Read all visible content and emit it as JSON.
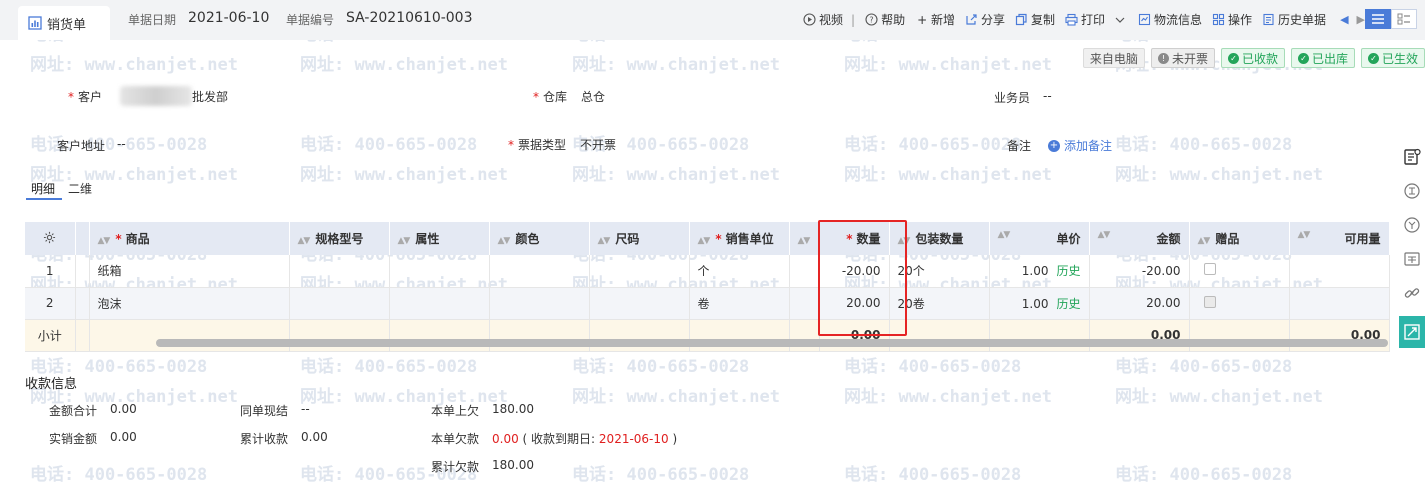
{
  "header": {
    "doc_title": "销货单",
    "date_label": "单据日期",
    "date_value": "2021-06-10",
    "number_label": "单据编号",
    "number_value": "SA-20210610-003"
  },
  "toolbar": {
    "video": "视频",
    "separator": "|",
    "help": "帮助",
    "add": "+ 新增",
    "share": "分享",
    "copy": "复制",
    "print": "打印",
    "logistics": "物流信息",
    "operate": "操作",
    "history": "历史单据"
  },
  "status_badges": {
    "source": "来自电脑",
    "invoice": "未开票",
    "received": "已收款",
    "shipped": "已出库",
    "effective": "已生效"
  },
  "form": {
    "customer_label": "客户",
    "customer_value": "批发部",
    "warehouse_label": "仓库",
    "warehouse_value": "总仓",
    "salesman_label": "业务员",
    "salesman_value": "--",
    "address_label": "客户地址",
    "address_value": "--",
    "invoice_type_label": "票据类型",
    "invoice_type_value": "不开票",
    "remark_label": "备注",
    "add_remark": "添加备注",
    "required_mark": "*"
  },
  "detail_tabs": {
    "detail": "明细",
    "dimension": "二维"
  },
  "table": {
    "headers": {
      "product": "商品",
      "spec": "规格型号",
      "attr": "属性",
      "color": "颜色",
      "size": "尺码",
      "sale_unit": "销售单位",
      "qty": "数量",
      "pack_qty": "包装数量",
      "price": "单价",
      "amount": "金额",
      "gift": "赠品",
      "available": "可用量"
    },
    "rows": [
      {
        "no": "1",
        "product": "纸箱",
        "unit": "个",
        "qty": "-20.00",
        "pack_qty": "20个",
        "price": "1.00",
        "history": "历史",
        "amount": "-20.00"
      },
      {
        "no": "2",
        "product": "泡沫",
        "unit": "卷",
        "qty": "20.00",
        "pack_qty": "20卷",
        "price": "1.00",
        "history": "历史",
        "amount": "20.00"
      }
    ],
    "subtotal": {
      "label": "小计",
      "qty": "0.00",
      "amount": "0.00",
      "available": "0.00"
    }
  },
  "receipt": {
    "title": "收款信息",
    "total_amount_label": "金额合计",
    "total_amount_value": "0.00",
    "same_bill_label": "同单现结",
    "same_bill_value": "--",
    "prev_owed_label": "本单上欠",
    "prev_owed_value": "180.00",
    "actual_sale_label": "实销金额",
    "actual_sale_value": "0.00",
    "cum_received_label": "累计收款",
    "cum_received_value": "0.00",
    "this_owed_label": "本单欠款",
    "this_owed_value": "0.00",
    "due_open": "( 收款到期日:",
    "due_date": "2021-06-10",
    "due_close": ")",
    "cum_owed_label": "累计欠款",
    "cum_owed_value": "180.00"
  },
  "watermark": {
    "phone": "电话: 400-665-0028",
    "site": "网址: www.chanjet.net"
  },
  "colors": {
    "accent": "#4a7bd8",
    "success": "#23a55a",
    "danger": "#e02020",
    "teal": "#2bb5a9"
  }
}
